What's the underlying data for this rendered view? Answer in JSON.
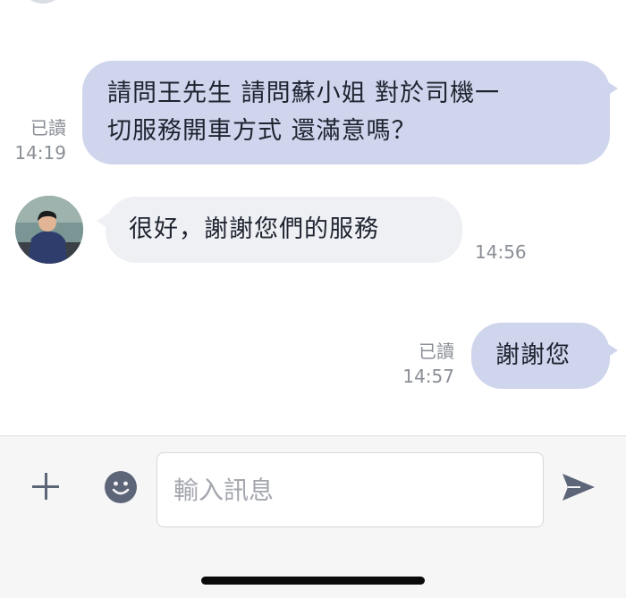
{
  "messages": [
    {
      "direction": "outgoing",
      "text_lines": [
        "請問王先生 請問蘇小姐 對於司機一",
        "切服務開車方式 還滿意嗎？"
      ],
      "read_label": "已讀",
      "time": "14:19"
    },
    {
      "direction": "incoming",
      "text": "很好，謝謝您們的服務",
      "time": "14:56"
    },
    {
      "direction": "outgoing",
      "text": "謝謝您",
      "read_label": "已讀",
      "time": "14:57"
    }
  ],
  "input_bar": {
    "placeholder": "輸入訊息",
    "icons": [
      "plus-icon",
      "emoji-icon",
      "send-icon"
    ],
    "colors": {
      "icon": "#5d6578",
      "outgoing_bubble": "#cfd5ec",
      "incoming_bubble": "#eef0f4"
    }
  }
}
